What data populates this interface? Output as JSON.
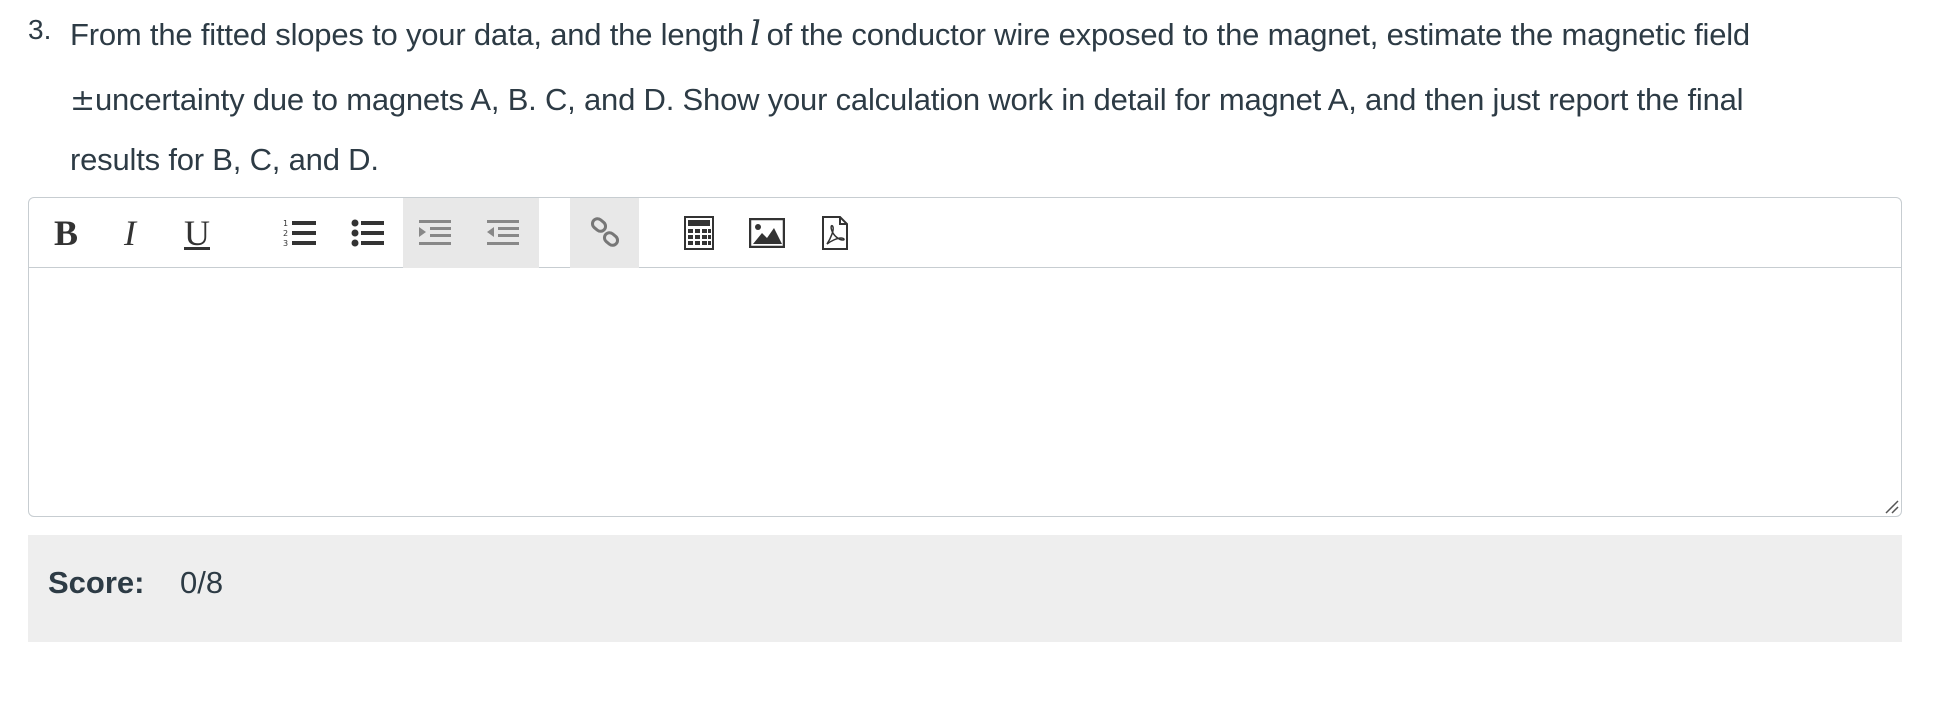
{
  "question": {
    "number": "3.",
    "line1_before": "From the fitted slopes to your data, and the length",
    "variable": "l",
    "line1_after": "of the conductor wire exposed to the magnet, estimate the magnetic field",
    "pm_symbol": "±",
    "line2": "uncertainty due to magnets A, B. C, and D. Show your calculation work in detail for magnet A, and then just report the final",
    "line3": "results for B, C, and D."
  },
  "toolbar": {
    "bold_label": "B",
    "italic_label": "I",
    "underline_label": "U",
    "icons": [
      "numbered-list-icon",
      "bullet-list-icon",
      "indent-icon",
      "outdent-icon",
      "link-icon",
      "calculator-icon",
      "image-icon",
      "pdf-document-icon"
    ]
  },
  "editor": {
    "content": ""
  },
  "score": {
    "label": "Score:",
    "value": "0/8"
  }
}
